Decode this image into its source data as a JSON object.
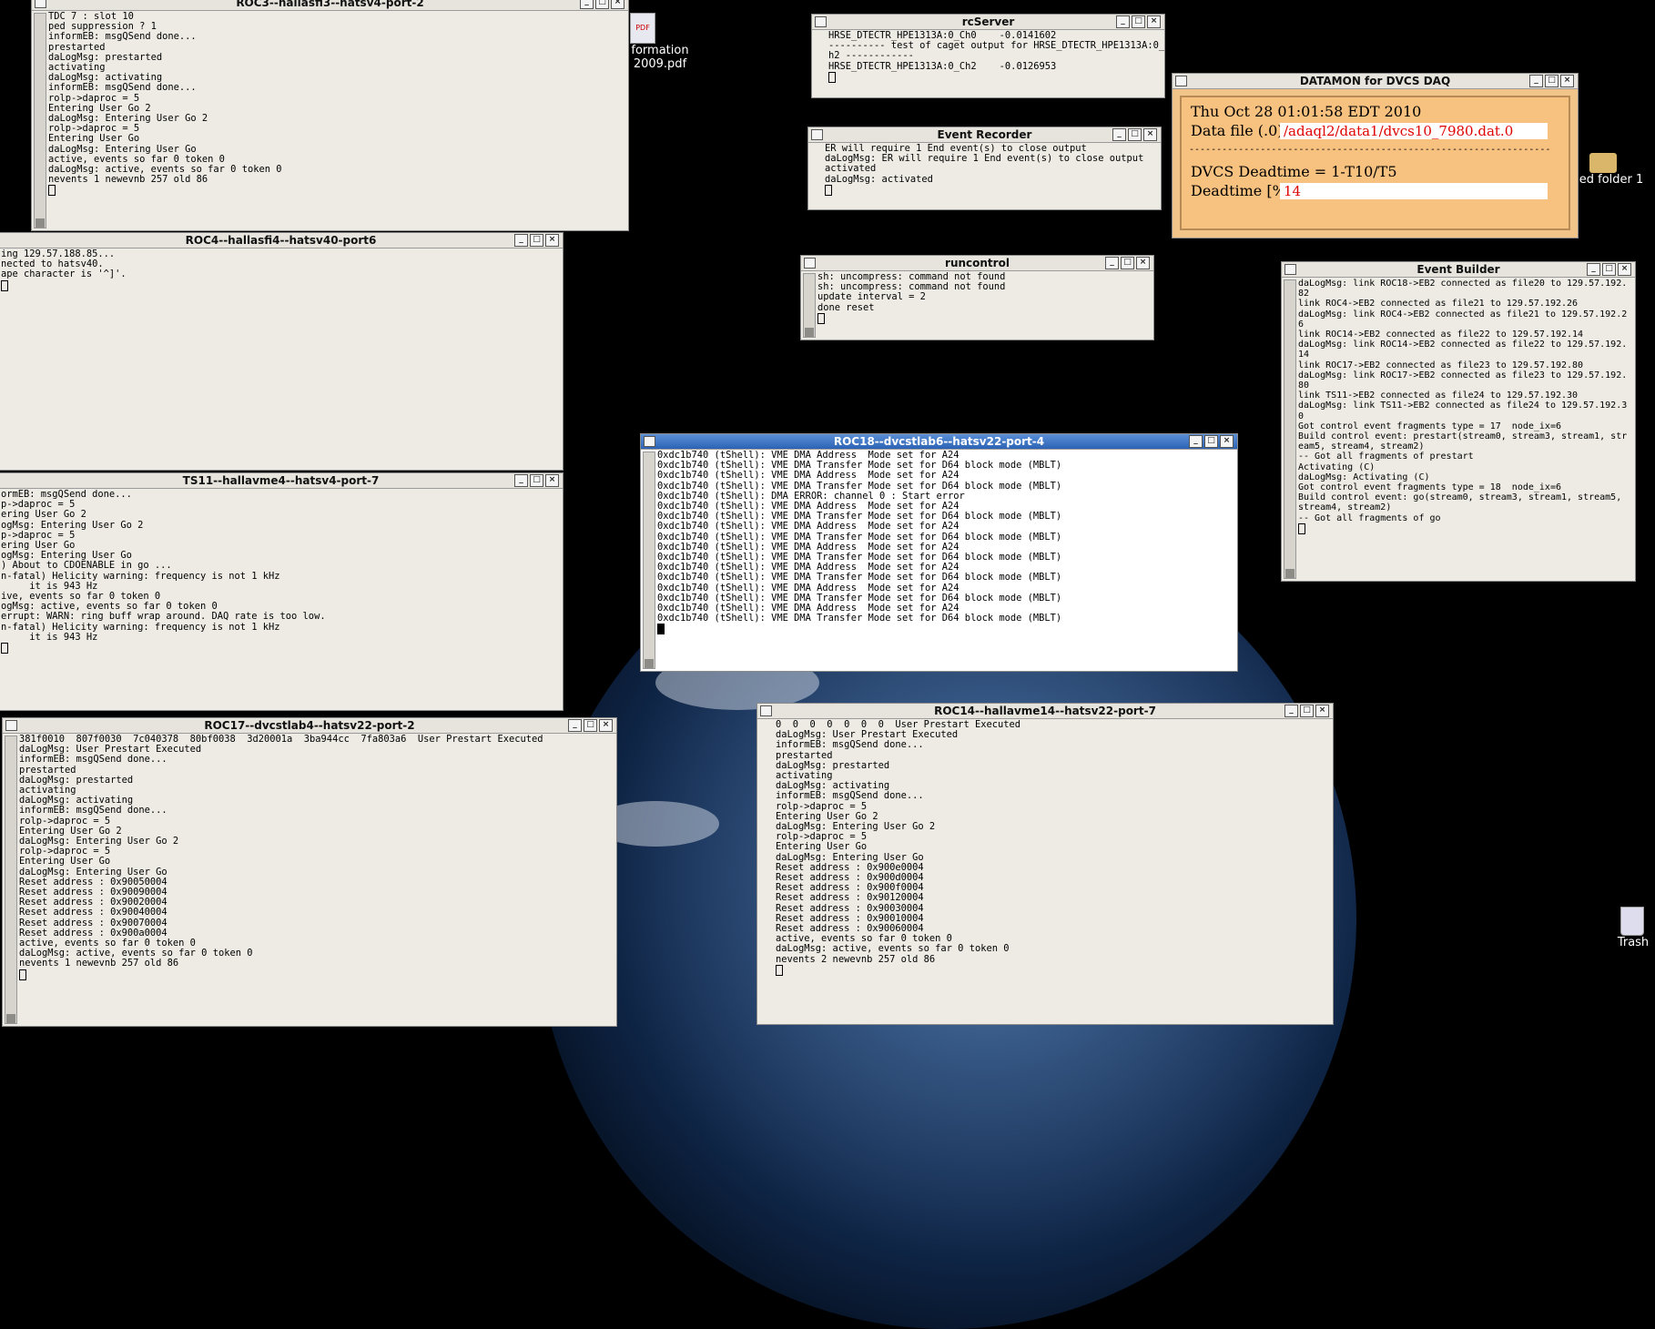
{
  "desktop": {
    "pdf_icon_label_1": "formation",
    "pdf_icon_label_2": "2009.pdf",
    "folder_icon_label": "ed folder 1",
    "trash_label": "Trash"
  },
  "windows": {
    "roc3": {
      "title": "ROC3--hallasfi3--hatsv4-port-2",
      "lines": [
        "TDC 7 : slot 10",
        "ped suppression ? 1",
        "informEB: msgQSend done...",
        "prestarted",
        "daLogMsg: prestarted",
        "activating",
        "daLogMsg: activating",
        "informEB: msgQSend done...",
        "rolp->daproc = 5",
        "Entering User Go 2",
        "daLogMsg: Entering User Go 2",
        "rolp->daproc = 5",
        "Entering User Go",
        "daLogMsg: Entering User Go",
        "active, events so far 0 token 0",
        "daLogMsg: active, events so far 0 token 0",
        "nevents 1 newevnb 257 old 86"
      ]
    },
    "roc4": {
      "title": "ROC4--hallasfi4--hatsv40-port6",
      "lines": [
        "ing 129.57.188.85...",
        "nected to hatsv40.",
        "ape character is '^]'."
      ]
    },
    "ts11": {
      "title": "TS11--hallavme4--hatsv4-port-7",
      "lines": [
        "ormEB: msgQSend done...",
        "p->daproc = 5",
        "ering User Go 2",
        "ogMsg: Entering User Go 2",
        "p->daproc = 5",
        "ering User Go",
        "ogMsg: Entering User Go",
        ") About to CDOENABLE in go ...",
        "",
        "n-fatal) Helicity warning: frequency is not 1 kHz",
        "     it is 943 Hz",
        "ive, events so far 0 token 0",
        "ogMsg: active, events so far 0 token 0",
        "errupt: WARN: ring buff wrap around. DAQ rate is too low.",
        "",
        "n-fatal) Helicity warning: frequency is not 1 kHz",
        "     it is 943 Hz"
      ]
    },
    "roc17": {
      "title": "ROC17--dvcstlab4--hatsv22-port-2",
      "lines": [
        "381f0010  807f0030  7c040378  80bf0038  3d20001a  3ba944cc  7fa803a6  User Prestart Executed",
        "daLogMsg: User Prestart Executed",
        "informEB: msgQSend done...",
        "prestarted",
        "daLogMsg: prestarted",
        "activating",
        "daLogMsg: activating",
        "informEB: msgQSend done...",
        "rolp->daproc = 5",
        "Entering User Go 2",
        "daLogMsg: Entering User Go 2",
        "rolp->daproc = 5",
        "Entering User Go",
        "daLogMsg: Entering User Go",
        "Reset address : 0x90050004",
        "Reset address : 0x90090004",
        "Reset address : 0x90020004",
        "Reset address : 0x90040004",
        "Reset address : 0x90070004",
        "Reset address : 0x900a0004",
        "active, events so far 0 token 0",
        "daLogMsg: active, events so far 0 token 0",
        "nevents 1 newevnb 257 old 86"
      ]
    },
    "rcserver": {
      "title": "rcServer",
      "lines": [
        "HRSE_DTECTR_HPE1313A:0_Ch0    -0.0141602",
        "---------- test of caget output for HRSE_DTECTR_HPE1313A:0_C",
        "h2 ------------",
        "HRSE_DTECTR_HPE1313A:0_Ch2    -0.0126953"
      ]
    },
    "eventrecorder": {
      "title": "Event Recorder",
      "lines": [
        "ER will require 1 End event(s) to close output",
        "daLogMsg: ER will require 1 End event(s) to close output",
        "activated",
        "daLogMsg: activated"
      ]
    },
    "runcontrol": {
      "title": "runcontrol",
      "lines": [
        "sh: uncompress: command not found",
        "sh: uncompress: command not found",
        "update interval = 2",
        "done reset"
      ]
    },
    "roc18": {
      "title": "ROC18--dvcstlab6--hatsv22-port-4",
      "lines": [
        "0xdc1b740 (tShell): VME DMA Address  Mode set for A24",
        "0xdc1b740 (tShell): VME DMA Transfer Mode set for D64 block mode (MBLT)",
        "0xdc1b740 (tShell): VME DMA Address  Mode set for A24",
        "0xdc1b740 (tShell): VME DMA Transfer Mode set for D64 block mode (MBLT)",
        "0xdc1b740 (tShell): DMA ERROR: channel 0 : Start error",
        "0xdc1b740 (tShell): VME DMA Address  Mode set for A24",
        "0xdc1b740 (tShell): VME DMA Transfer Mode set for D64 block mode (MBLT)",
        "0xdc1b740 (tShell): VME DMA Address  Mode set for A24",
        "0xdc1b740 (tShell): VME DMA Transfer Mode set for D64 block mode (MBLT)",
        "0xdc1b740 (tShell): VME DMA Address  Mode set for A24",
        "0xdc1b740 (tShell): VME DMA Transfer Mode set for D64 block mode (MBLT)",
        "0xdc1b740 (tShell): VME DMA Address  Mode set for A24",
        "0xdc1b740 (tShell): VME DMA Transfer Mode set for D64 block mode (MBLT)",
        "0xdc1b740 (tShell): VME DMA Address  Mode set for A24",
        "0xdc1b740 (tShell): VME DMA Transfer Mode set for D64 block mode (MBLT)",
        "0xdc1b740 (tShell): VME DMA Address  Mode set for A24",
        "0xdc1b740 (tShell): VME DMA Transfer Mode set for D64 block mode (MBLT)"
      ]
    },
    "roc14": {
      "title": "ROC14--hallavme14--hatsv22-port-7",
      "lines": [
        "0  0  0  0  0  0  0  User Prestart Executed",
        "daLogMsg: User Prestart Executed",
        "informEB: msgQSend done...",
        "prestarted",
        "daLogMsg: prestarted",
        "activating",
        "daLogMsg: activating",
        "informEB: msgQSend done...",
        "rolp->daproc = 5",
        "Entering User Go 2",
        "daLogMsg: Entering User Go 2",
        "rolp->daproc = 5",
        "Entering User Go",
        "daLogMsg: Entering User Go",
        "Reset address : 0x900e0004",
        "Reset address : 0x900d0004",
        "Reset address : 0x900f0004",
        "Reset address : 0x90120004",
        "Reset address : 0x90030004",
        "Reset address : 0x90010004",
        "Reset address : 0x90060004",
        "active, events so far 0 token 0",
        "daLogMsg: active, events so far 0 token 0",
        "nevents 2 newevnb 257 old 86"
      ]
    },
    "eventbuilder": {
      "title": "Event Builder",
      "lines": [
        "daLogMsg: link ROC18->EB2 connected as file20 to 129.57.192.",
        "82",
        "link ROC4->EB2 connected as file21 to 129.57.192.26",
        "daLogMsg: link ROC4->EB2 connected as file21 to 129.57.192.2",
        "6",
        "link ROC14->EB2 connected as file22 to 129.57.192.14",
        "daLogMsg: link ROC14->EB2 connected as file22 to 129.57.192.",
        "14",
        "link ROC17->EB2 connected as file23 to 129.57.192.80",
        "daLogMsg: link ROC17->EB2 connected as file23 to 129.57.192.",
        "80",
        "link TS11->EB2 connected as file24 to 129.57.192.30",
        "daLogMsg: link TS11->EB2 connected as file24 to 129.57.192.3",
        "0",
        "Got control event fragments type = 17  node_ix=6",
        "Build control event: prestart(stream0, stream3, stream1, str",
        "eam5, stream4, stream2)",
        "-- Got all fragments of prestart",
        "Activating (C)",
        "daLogMsg: Activating (C)",
        "Got control event fragments type = 18  node_ix=6",
        "Build control event: go(stream0, stream3, stream1, stream5,",
        "stream4, stream2)",
        "-- Got all fragments of go"
      ]
    },
    "datamon": {
      "title": "DATAMON  for DVCS DAQ",
      "date": "Thu Oct 28 01:01:58 EDT 2010",
      "datafile_label": "Data file (.0)",
      "datafile_value": "/adaql2/data1/dvcs10_7980.dat.0",
      "separator": "------------------------------------------------------------------",
      "deadtime_formula": "DVCS Deadtime = 1-T10/T5",
      "deadtime_label": "Deadtime [%]:",
      "deadtime_value": "14",
      "value_color": "#e00000"
    }
  }
}
